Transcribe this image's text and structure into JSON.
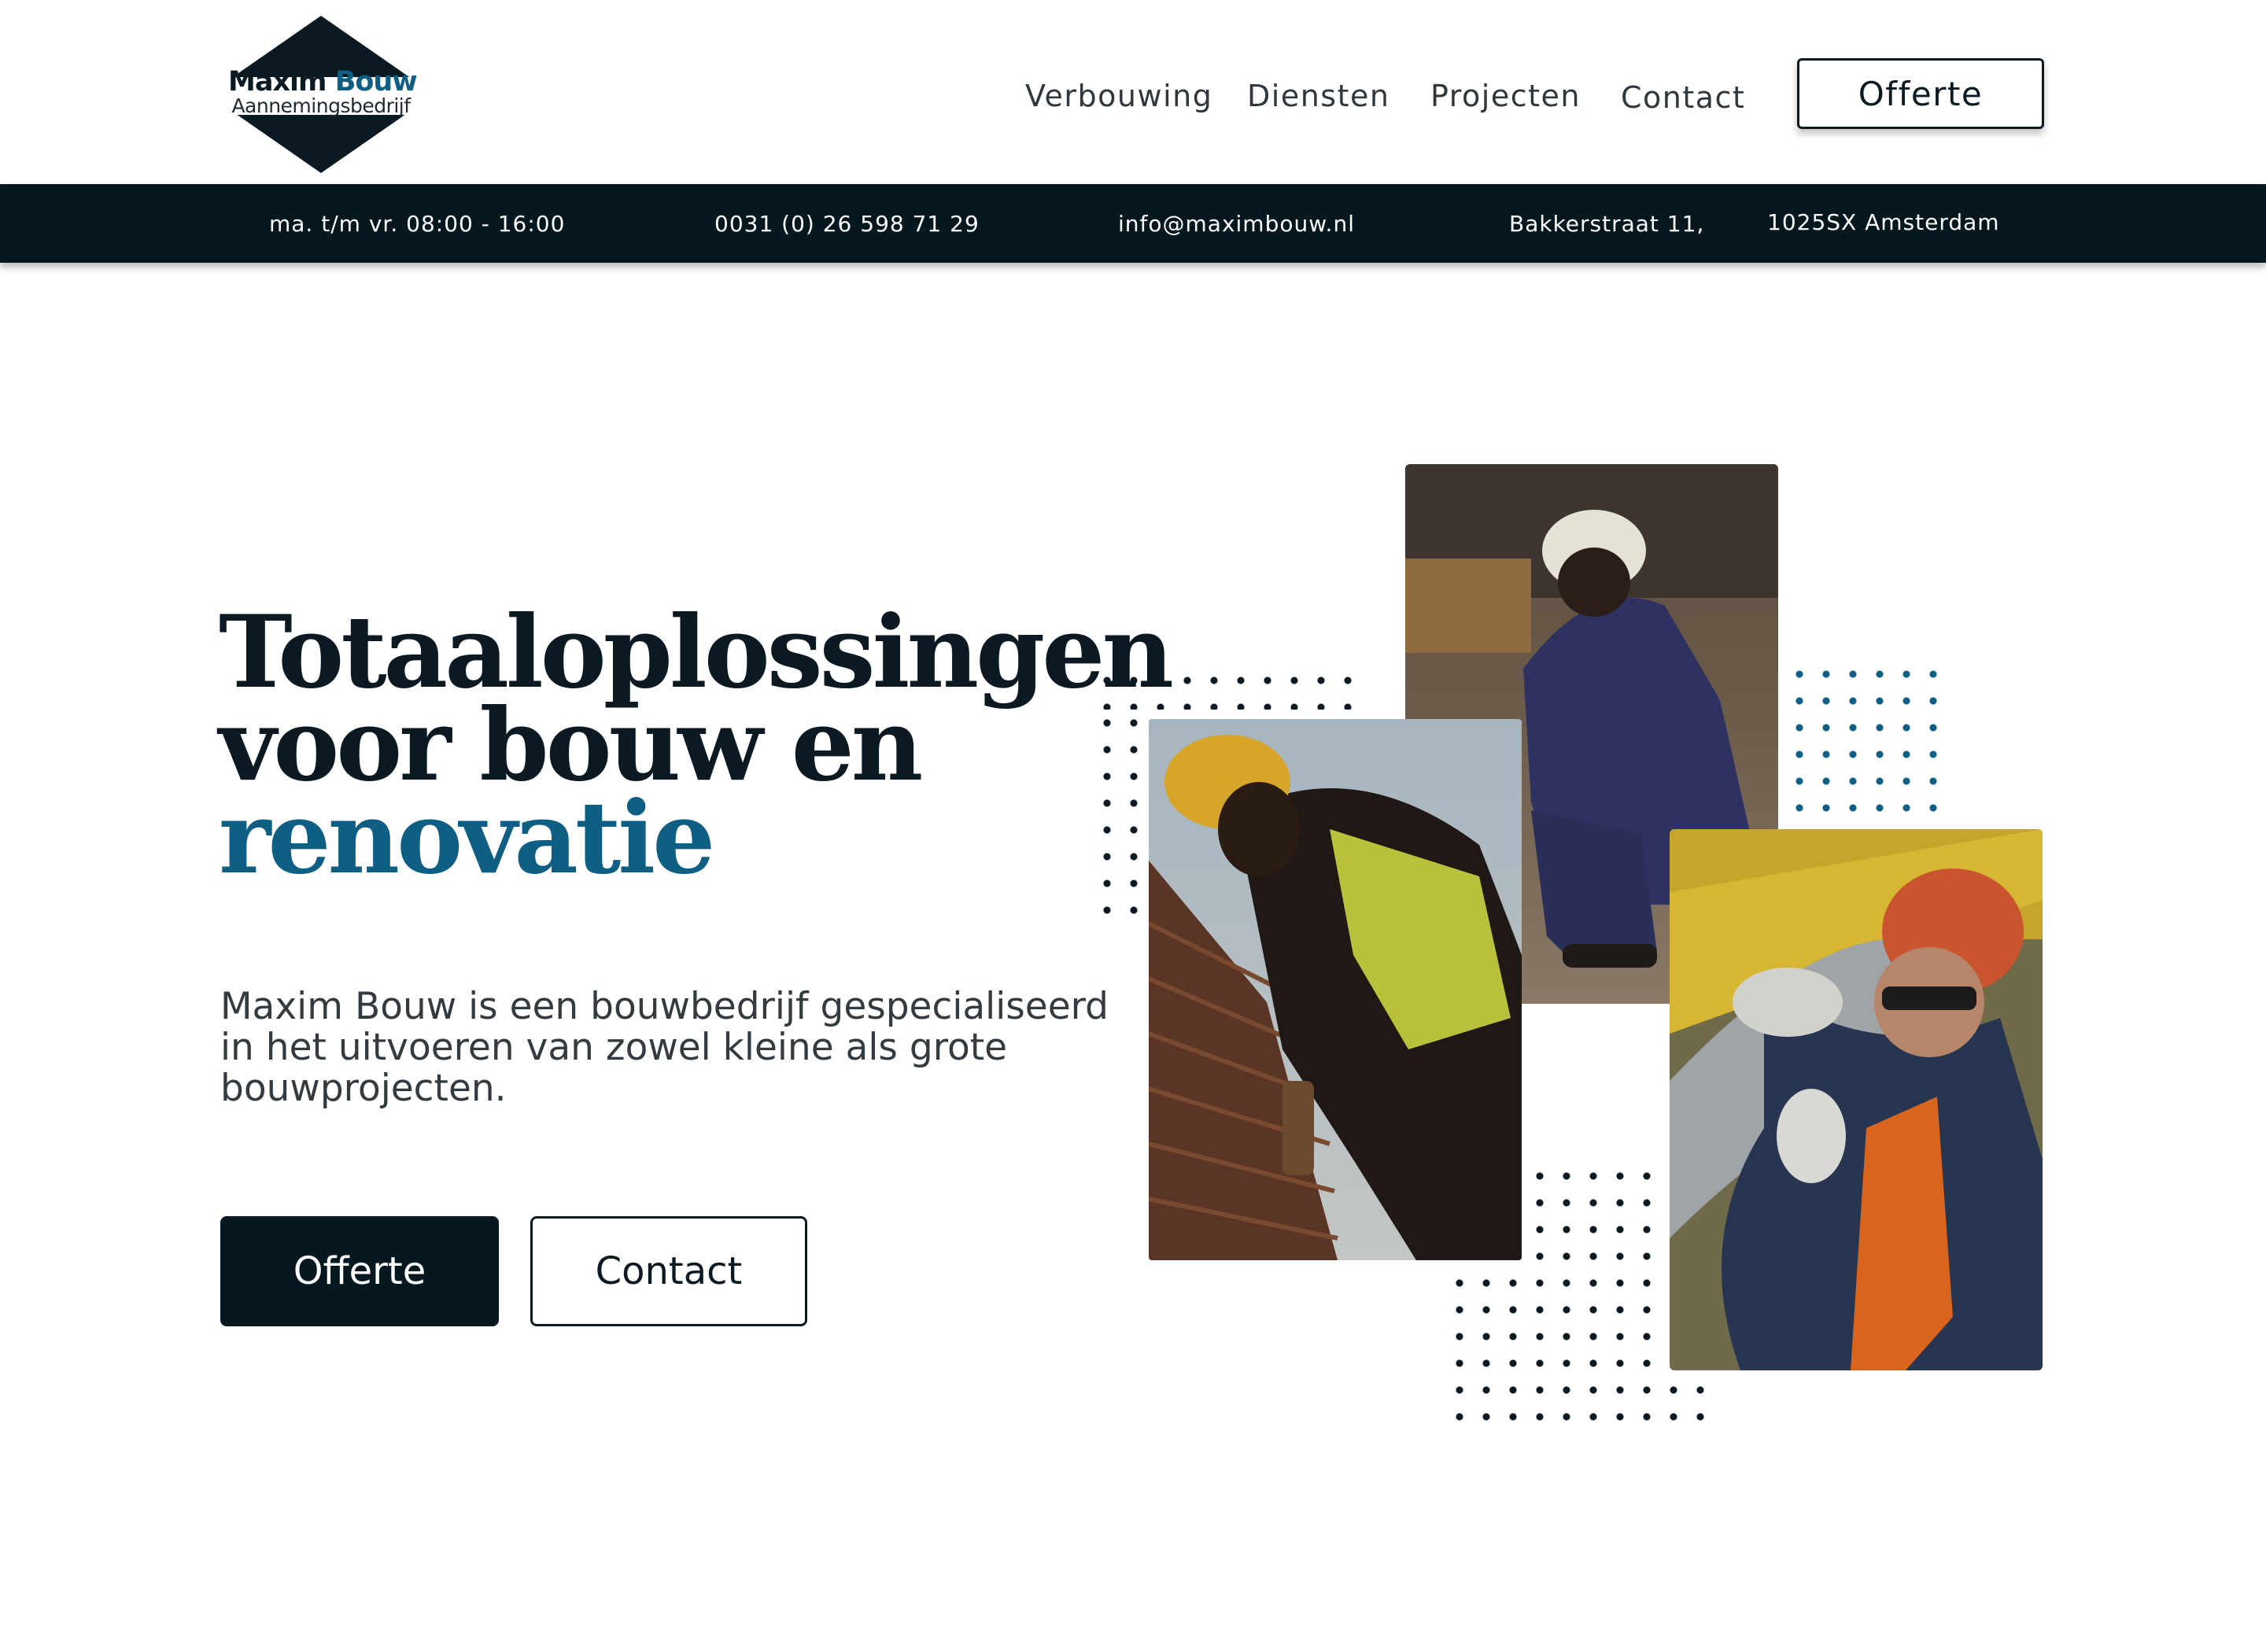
{
  "brand": {
    "name_part1": "Maxim",
    "name_part2": "Bouw",
    "subtitle": "Aannemingsbedrijf",
    "colors": {
      "dark": "#0b1a22",
      "accent": "#0f5f85",
      "bar": "#051820"
    }
  },
  "nav": {
    "items": [
      "Verbouwing",
      "Diensten",
      "Projecten",
      "Contact"
    ],
    "cta_label": "Offerte"
  },
  "infobar": {
    "hours": "ma. t/m vr.  08:00 - 16:00",
    "phone": "0031 (0) 26 598 71 29",
    "email": "info@maximbouw.nl",
    "street": "Bakkerstraat 11,",
    "city": "1025SX Amsterdam"
  },
  "hero": {
    "headline_line1": "Totaaloplossingen",
    "headline_line2": "voor bouw en",
    "headline_accent": "renovatie",
    "lead": "Maxim Bouw is een bouwbedrijf gespecialiseerd in het uitvoeren van zowel kleine als grote bouwprojecten.",
    "primary_button": "Offerte",
    "secondary_button": "Contact"
  }
}
